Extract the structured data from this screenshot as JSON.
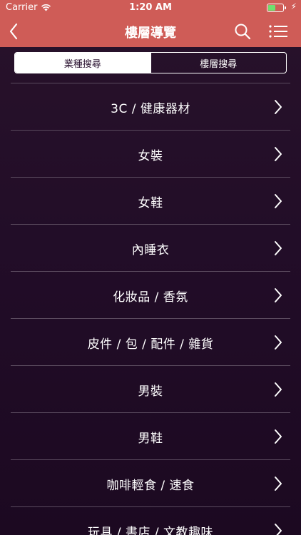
{
  "status_bar": {
    "carrier": "Carrier",
    "time": "1:20 AM"
  },
  "nav": {
    "title": "樓層導覽",
    "icons": [
      "back-chevron-icon",
      "search-icon",
      "list-menu-icon"
    ]
  },
  "segments": {
    "active": "業種搜尋",
    "inactive": "樓層搜尋"
  },
  "categories": [
    "3C / 健康器材",
    "女裝",
    "女鞋",
    "內睡衣",
    "化妝品 / 香氛",
    "皮件 / 包 / 配件 / 雜貨",
    "男裝",
    "男鞋",
    "咖啡輕食 / 速食",
    "玩具 / 書店 / 文教趣味"
  ],
  "colors": {
    "header": "#cf5c57",
    "background": "#220d28",
    "divider": "#5a4a5e",
    "battery": "#6fe06f"
  }
}
